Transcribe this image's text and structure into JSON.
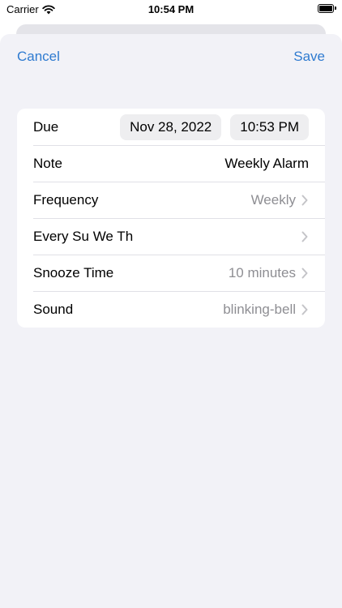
{
  "status_bar": {
    "carrier": "Carrier",
    "time": "10:54 PM",
    "icons": [
      "wifi-icon",
      "battery-icon"
    ]
  },
  "nav": {
    "cancel_label": "Cancel",
    "save_label": "Save",
    "accent_color": "#2f7bd0"
  },
  "form": {
    "due": {
      "label": "Due",
      "date": "Nov 28, 2022",
      "time": "10:53 PM"
    },
    "note": {
      "label": "Note",
      "value": "Weekly Alarm"
    },
    "frequency": {
      "label": "Frequency",
      "value": "Weekly"
    },
    "days": {
      "label": "Every Su We Th"
    },
    "snooze": {
      "label": "Snooze Time",
      "value": "10 minutes"
    },
    "sound": {
      "label": "Sound",
      "value": "blinking-bell"
    }
  }
}
